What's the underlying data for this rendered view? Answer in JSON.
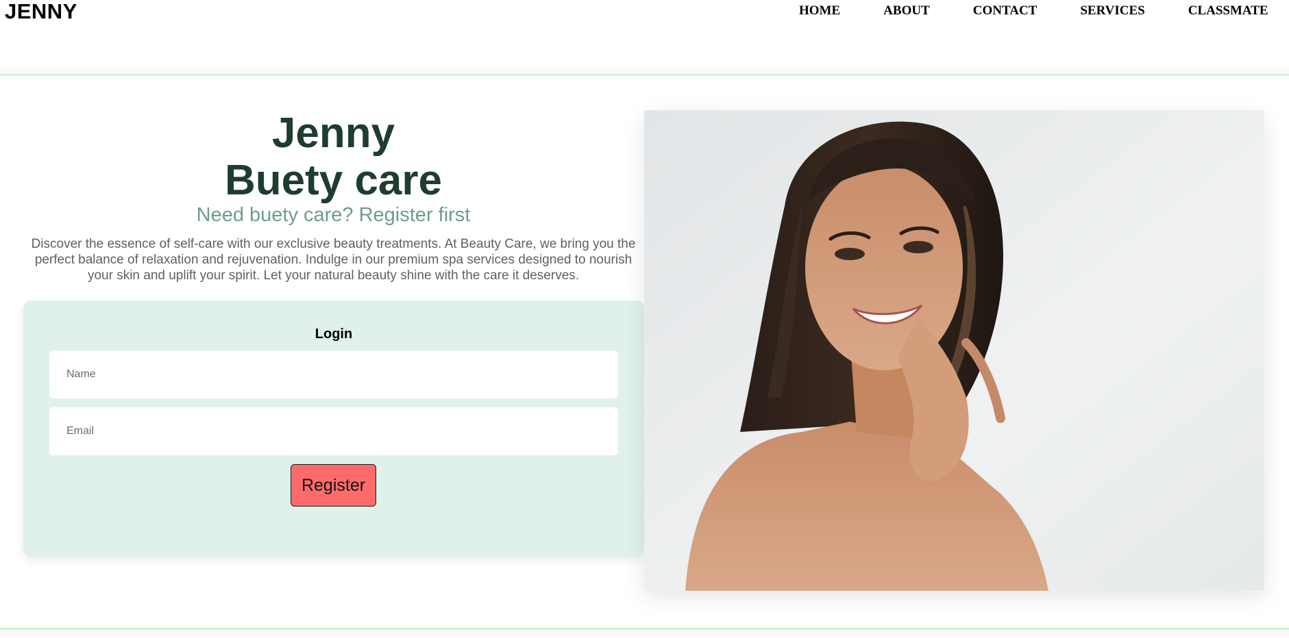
{
  "header": {
    "brand": "JENNY",
    "nav": [
      "HOME",
      "ABOUT",
      "CONTACT",
      "SERVICES",
      "CLASSMATE"
    ]
  },
  "hero": {
    "title_line1": "Jenny",
    "title_line2": "Buety care",
    "subtitle": "Need buety care? Register first",
    "description": "Discover the essence of self-care with our exclusive beauty treatments. At Beauty Care, we bring you the perfect balance of relaxation and rejuvenation. Indulge in our premium spa services designed to nourish your skin and uplift your spirit. Let your natural beauty shine with the care it deserves."
  },
  "login": {
    "title": "Login",
    "name_placeholder": "Name",
    "email_placeholder": "Email",
    "register_label": "Register"
  },
  "colors": {
    "title": "#1e3d2f",
    "subtitle": "#6e9e86",
    "card_bg": "#e0f1ea",
    "register_bg": "#ff6b6b",
    "section_border": "#9be89b"
  },
  "image": {
    "subject": "portrait-of-smiling-woman"
  }
}
